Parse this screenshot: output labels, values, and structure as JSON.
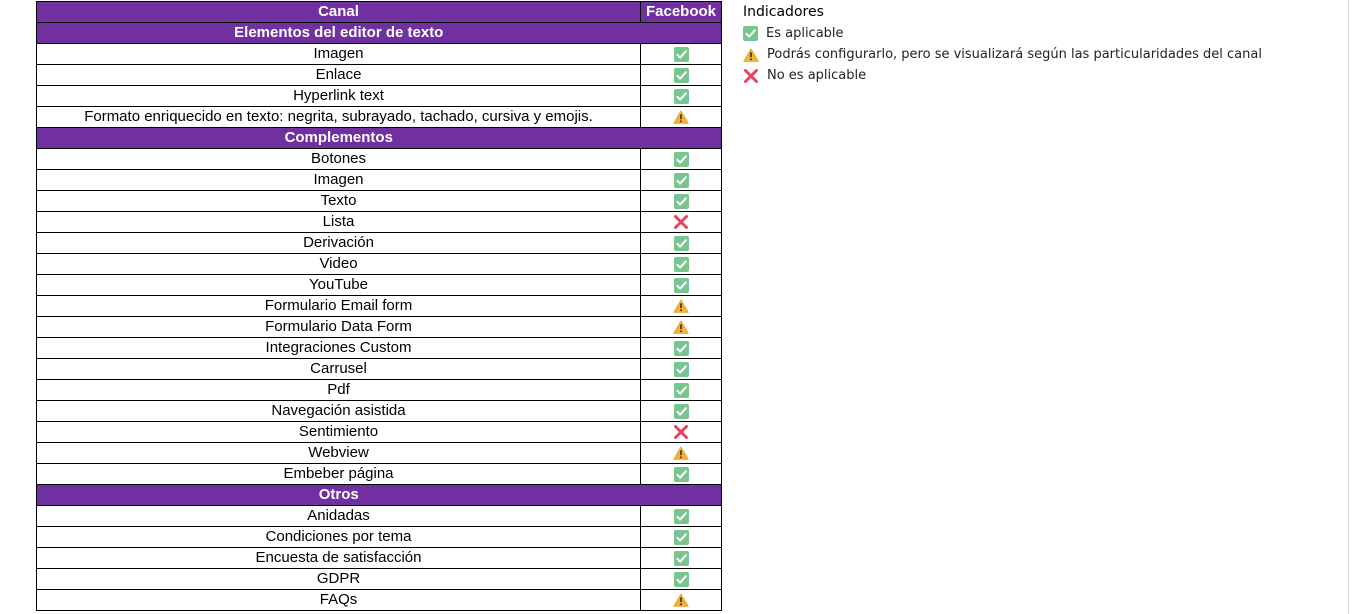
{
  "table": {
    "header": {
      "feature": "Canal",
      "channel": "Facebook"
    },
    "sections": [
      {
        "title": "Elementos del editor de texto",
        "rows": [
          {
            "label": "Imagen",
            "status": "check"
          },
          {
            "label": "Enlace",
            "status": "check"
          },
          {
            "label": "Hyperlink text",
            "status": "check"
          },
          {
            "label": "Formato enriquecido en texto: negrita, subrayado, tachado, cursiva y emojis.",
            "status": "warning"
          }
        ]
      },
      {
        "title": "Complementos",
        "rows": [
          {
            "label": "Botones",
            "status": "check"
          },
          {
            "label": "Imagen",
            "status": "check"
          },
          {
            "label": "Texto",
            "status": "check"
          },
          {
            "label": "Lista",
            "status": "cross"
          },
          {
            "label": "Derivación",
            "status": "check"
          },
          {
            "label": "Video",
            "status": "check"
          },
          {
            "label": "YouTube",
            "status": "check"
          },
          {
            "label": "Formulario Email form",
            "status": "warning"
          },
          {
            "label": "Formulario Data Form",
            "status": "warning"
          },
          {
            "label": "Integraciones Custom",
            "status": "check"
          },
          {
            "label": "Carrusel",
            "status": "check"
          },
          {
            "label": "Pdf",
            "status": "check"
          },
          {
            "label": "Navegación asistida",
            "status": "check"
          },
          {
            "label": "Sentimiento",
            "status": "cross"
          },
          {
            "label": "Webview",
            "status": "warning"
          },
          {
            "label": "Embeber página",
            "status": "check"
          }
        ]
      },
      {
        "title": "Otros",
        "rows": [
          {
            "label": "Anidadas",
            "status": "check"
          },
          {
            "label": "Condiciones por tema",
            "status": "check"
          },
          {
            "label": "Encuesta de satisfacción",
            "status": "check"
          },
          {
            "label": "GDPR",
            "status": "check"
          },
          {
            "label": "FAQs",
            "status": "warning"
          }
        ]
      }
    ]
  },
  "legend": {
    "title": "Indicadores",
    "items": [
      {
        "status": "check",
        "label": "Es aplicable"
      },
      {
        "status": "warning",
        "label": "Podrás configurarlo, pero se visualizará según las particularidades del canal"
      },
      {
        "status": "cross",
        "label": "No es aplicable"
      }
    ]
  },
  "icons": {
    "check": "check-mark-button-icon",
    "warning": "warning-icon",
    "cross": "cross-mark-icon"
  },
  "colors": {
    "header_bg": "#7030a0",
    "header_text": "#ffffff",
    "check_bg": "#78c58f",
    "warning": "#f2b134",
    "cross": "#e8415e"
  }
}
